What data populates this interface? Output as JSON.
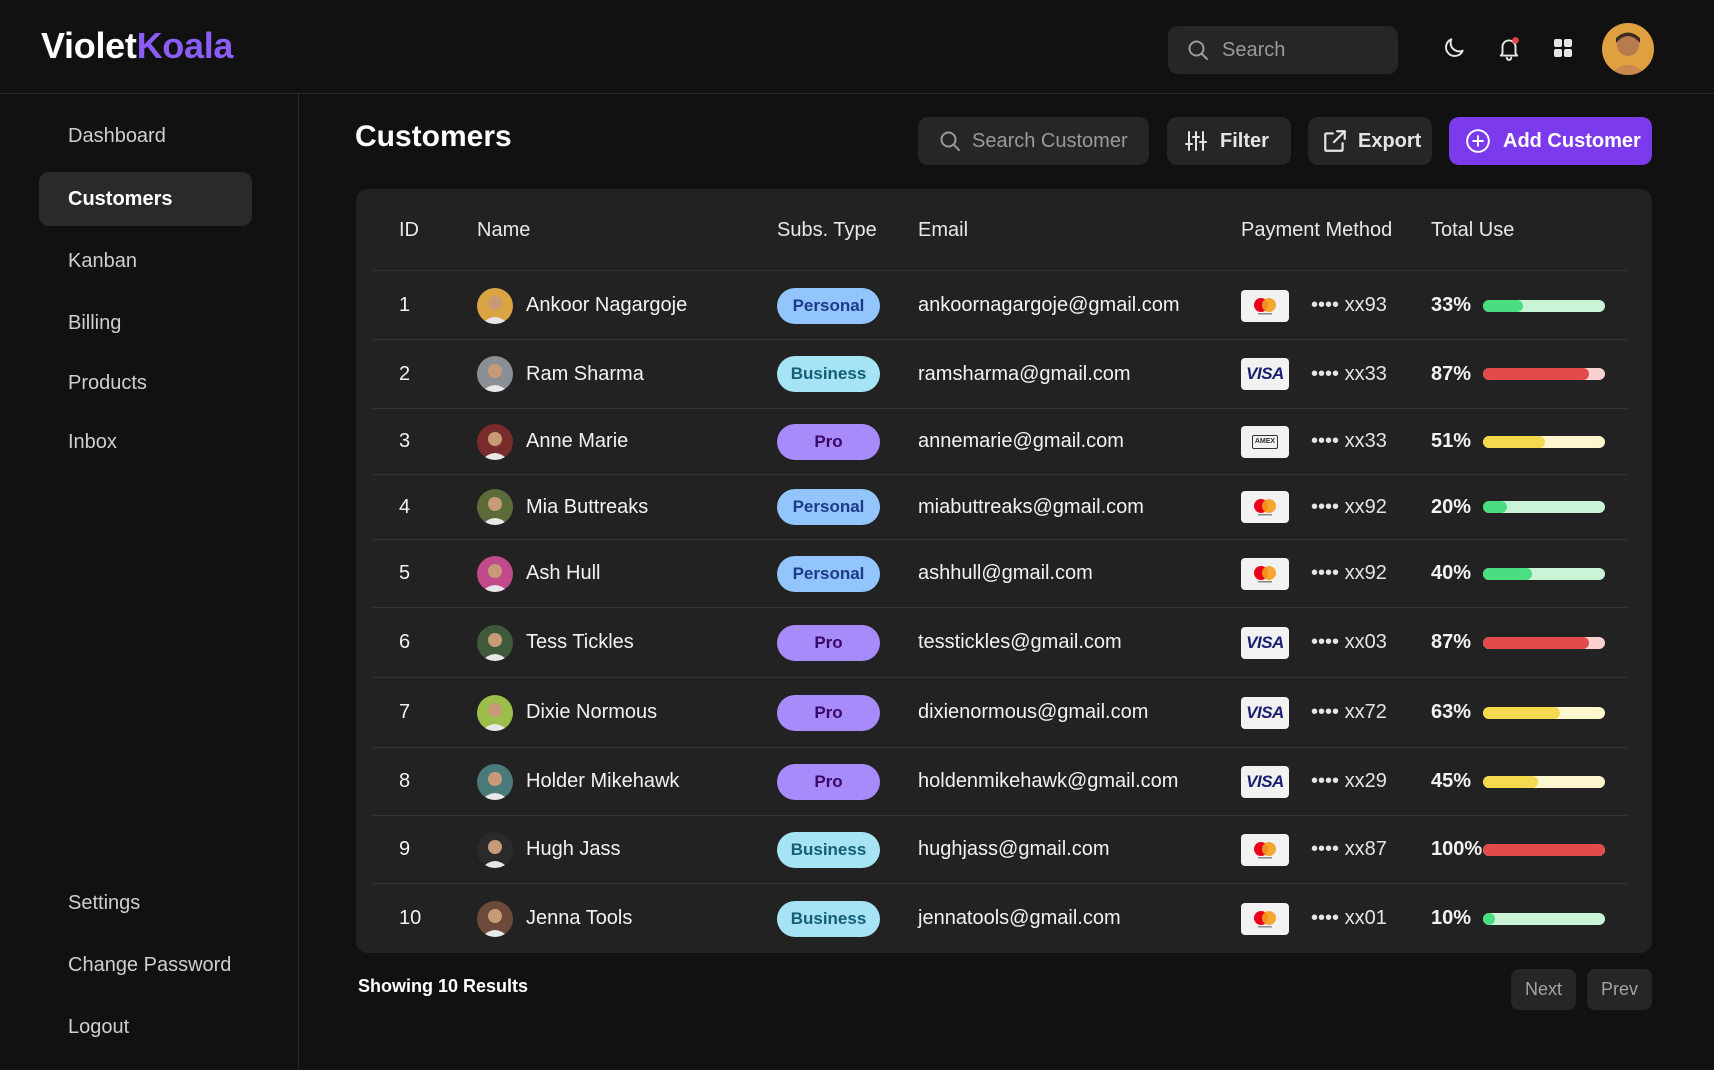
{
  "app": {
    "logo_part1": "Violet",
    "logo_part2": "Koala"
  },
  "topbar": {
    "search_placeholder": "Search"
  },
  "sidebar": {
    "items": [
      {
        "label": "Dashboard"
      },
      {
        "label": "Customers",
        "active": true
      },
      {
        "label": "Kanban"
      },
      {
        "label": "Billing"
      },
      {
        "label": "Products"
      },
      {
        "label": "Inbox"
      }
    ],
    "bottom_items": [
      {
        "label": "Settings"
      },
      {
        "label": "Change Password"
      },
      {
        "label": "Logout"
      }
    ]
  },
  "main": {
    "title": "Customers",
    "search_placeholder": "Search Customer",
    "filter_label": "Filter",
    "export_label": "Export",
    "add_label": "Add Customer"
  },
  "table": {
    "headers": {
      "id": "ID",
      "name": "Name",
      "type": "Subs. Type",
      "email": "Email",
      "payment": "Payment Method",
      "use": "Total Use"
    },
    "rows": [
      {
        "id": "1",
        "name": "Ankoor Nagargoje",
        "type": "Personal",
        "email": "ankoornagargoje@gmail.com",
        "card": "mastercard",
        "masked": "•••• xx93",
        "use": "33%",
        "use_value": 0.33,
        "level": "green"
      },
      {
        "id": "2",
        "name": "Ram Sharma",
        "type": "Business",
        "email": "ramsharma@gmail.com",
        "card": "visa",
        "masked": "•••• xx33",
        "use": "87%",
        "use_value": 0.87,
        "level": "red"
      },
      {
        "id": "3",
        "name": "Anne Marie",
        "type": "Pro",
        "email": "annemarie@gmail.com",
        "card": "amex",
        "masked": "•••• xx33",
        "use": "51%",
        "use_value": 0.51,
        "level": "yellow"
      },
      {
        "id": "4",
        "name": "Mia Buttreaks",
        "type": "Personal",
        "email": "miabuttreaks@gmail.com",
        "card": "mastercard",
        "masked": "•••• xx92",
        "use": "20%",
        "use_value": 0.2,
        "level": "green"
      },
      {
        "id": "5",
        "name": "Ash Hull",
        "type": "Personal",
        "email": "ashhull@gmail.com",
        "card": "mastercard",
        "masked": "•••• xx92",
        "use": "40%",
        "use_value": 0.4,
        "level": "green"
      },
      {
        "id": "6",
        "name": "Tess Tickles",
        "type": "Pro",
        "email": "tesstickles@gmail.com",
        "card": "visa",
        "masked": "•••• xx03",
        "use": "87%",
        "use_value": 0.87,
        "level": "red"
      },
      {
        "id": "7",
        "name": "Dixie Normous",
        "type": "Pro",
        "email": "dixienormous@gmail.com",
        "card": "visa",
        "masked": "•••• xx72",
        "use": "63%",
        "use_value": 0.63,
        "level": "yellow"
      },
      {
        "id": "8",
        "name": "Holder Mikehawk",
        "type": "Pro",
        "email": "holdenmikehawk@gmail.com",
        "card": "visa",
        "masked": "•••• xx29",
        "use": "45%",
        "use_value": 0.45,
        "level": "yellow"
      },
      {
        "id": "9",
        "name": "Hugh Jass",
        "type": "Business",
        "email": "hughjass@gmail.com",
        "card": "mastercard",
        "masked": "•••• xx87",
        "use": "100%",
        "use_value": 1.0,
        "level": "red"
      },
      {
        "id": "10",
        "name": "Jenna Tools",
        "type": "Business",
        "email": "jennatools@gmail.com",
        "card": "mastercard",
        "masked": "•••• xx01",
        "use": "10%",
        "use_value": 0.1,
        "level": "green"
      }
    ]
  },
  "footer": {
    "results": "Showing 10 Results",
    "next": "Next",
    "prev": "Prev"
  },
  "colors": {
    "accent": "#7c3aed",
    "logo_accent": "#8b5cf6",
    "green": {
      "fill": "#4ade80",
      "track": "#c9f5d6"
    },
    "red": {
      "fill": "#e24b4b",
      "track": "#fbd0d0"
    },
    "yellow": {
      "fill": "#f5d94e",
      "track": "#fdf6cf"
    }
  }
}
